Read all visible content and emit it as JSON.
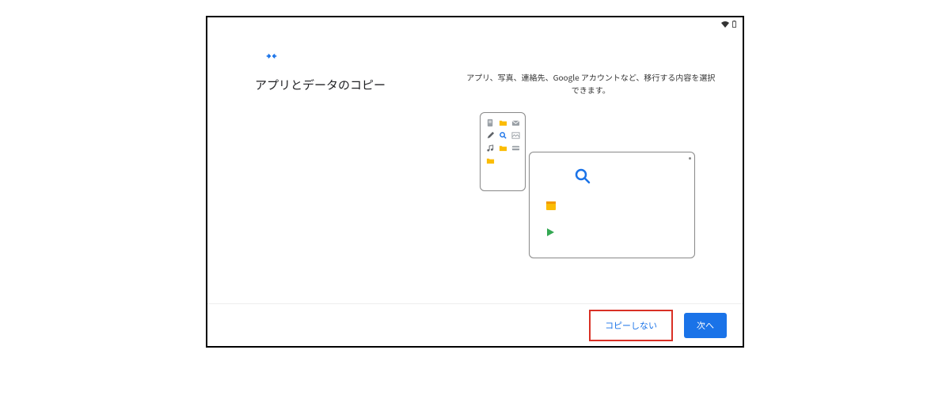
{
  "header": {
    "title": "アプリとデータのコピー"
  },
  "body": {
    "description": "アプリ、写真、連絡先、Google アカウントなど、移行する内容を選択できます。"
  },
  "buttons": {
    "skip": "コピーしない",
    "next": "次へ"
  },
  "colors": {
    "accent": "#1a73e8",
    "highlight": "#d93025"
  },
  "icons": {
    "header": "copy-arrows-icon",
    "phone_apps": [
      "document-icon",
      "folder-yellow-icon",
      "mail-icon",
      "pencil-icon",
      "search-blue-icon",
      "image-icon",
      "music-note-icon",
      "folder-yellow-icon",
      "card-icon",
      "folder-yellow-icon"
    ],
    "tablet_apps": [
      "search-blue-large-icon",
      "calendar-yellow-icon",
      "play-green-icon"
    ]
  }
}
